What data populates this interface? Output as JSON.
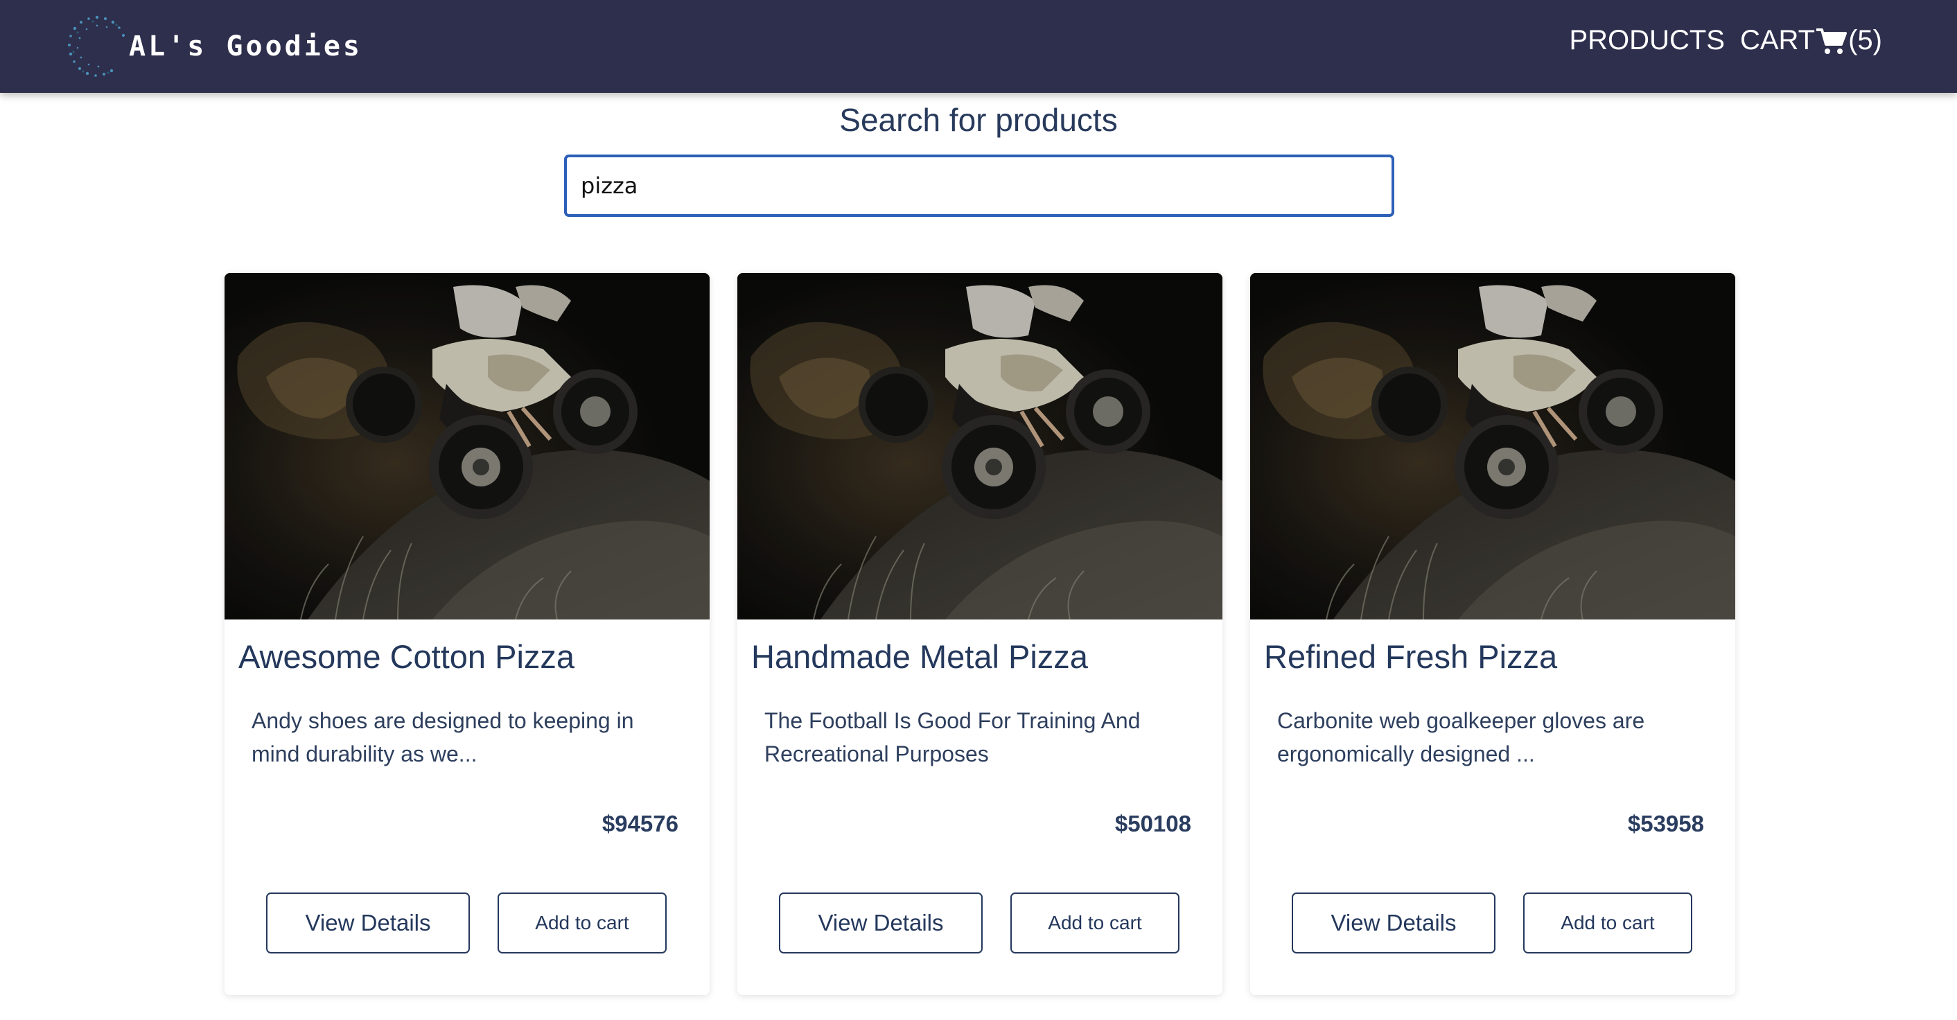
{
  "header": {
    "brand": "AL's Goodies",
    "nav": {
      "products": "PRODUCTS",
      "cart": "CART",
      "cart_count": "(5)"
    },
    "colors": {
      "background": "#2e2f4d",
      "text": "#ffffff"
    }
  },
  "search": {
    "title": "Search for products",
    "value": "pizza"
  },
  "products": [
    {
      "title": "Awesome Cotton Pizza",
      "description": "Andy shoes are designed to keeping in mind durability as we...",
      "price": "$94576",
      "image_icon": "atv-photo",
      "details_label": "View Details",
      "cart_label": "Add to cart"
    },
    {
      "title": "Handmade Metal Pizza",
      "description": "The Football Is Good For Training And Recreational Purposes",
      "price": "$50108",
      "image_icon": "atv-photo",
      "details_label": "View Details",
      "cart_label": "Add to cart"
    },
    {
      "title": "Refined Fresh Pizza",
      "description": "Carbonite web goalkeeper gloves are ergonomically designed ...",
      "price": "$53958",
      "image_icon": "atv-photo",
      "details_label": "View Details",
      "cart_label": "Add to cart"
    }
  ]
}
